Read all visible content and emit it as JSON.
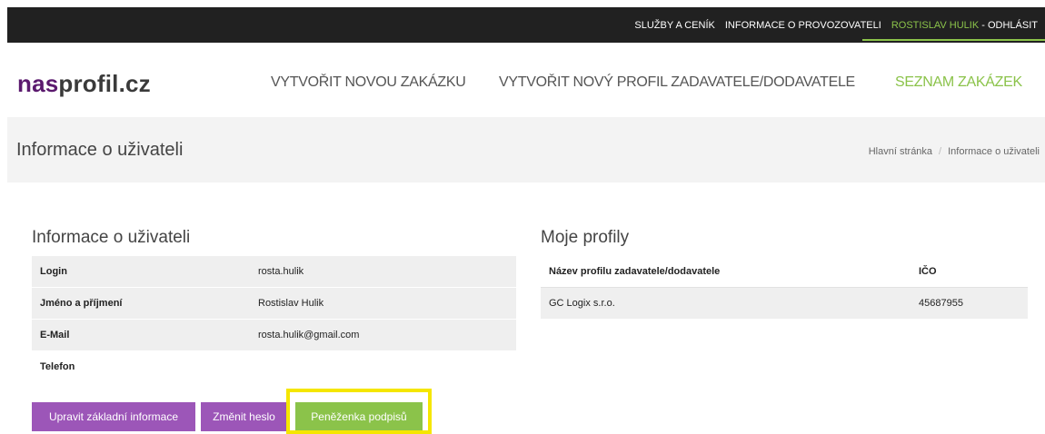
{
  "topbar": {
    "services": "SLUŽBY A CENÍK",
    "operator": "INFORMACE O PROVOZOVATELI",
    "user": "ROSTISLAV HULIK",
    "logout": " - ODHLÁSIT"
  },
  "header": {
    "logo_a": "nas",
    "logo_b": "profil.cz",
    "nav": [
      {
        "label": "VYTVOŘIT NOVOU ZAKÁZKU"
      },
      {
        "label": "VYTVOŘIT NOVÝ PROFIL ZADAVATELE/DODAVATELE"
      },
      {
        "label": "SEZNAM ZAKÁZEK"
      }
    ]
  },
  "title": {
    "heading": "Informace o uživateli",
    "breadcrumb_home": "Hlavní stránka",
    "breadcrumb_sep": "/",
    "breadcrumb_current": "Informace o uživateli"
  },
  "user_info": {
    "title": "Informace o uživateli",
    "rows": [
      {
        "key": "Login",
        "value": "rosta.hulik"
      },
      {
        "key": "Jméno a příjmení",
        "value": "Rostislav Hulik"
      },
      {
        "key": "E-Mail",
        "value": "rosta.hulik@gmail.com"
      },
      {
        "key": "Telefon",
        "value": ""
      }
    ],
    "buttons": {
      "edit": "Upravit základní informace",
      "password": "Změnit heslo",
      "wallet": "Peněženka podpisů"
    }
  },
  "profiles": {
    "title": "Moje profily",
    "header": {
      "name": "Název profilu zadavatele/dodavatele",
      "ico": "IČO"
    },
    "rows": [
      {
        "name": "GC Logix s.r.o.",
        "ico": "45687955"
      }
    ]
  },
  "colors": {
    "accent_green": "#8bc34a",
    "brand_purple": "#5b1a6e",
    "button_purple": "#9c56b8",
    "highlight": "#f5e600"
  }
}
